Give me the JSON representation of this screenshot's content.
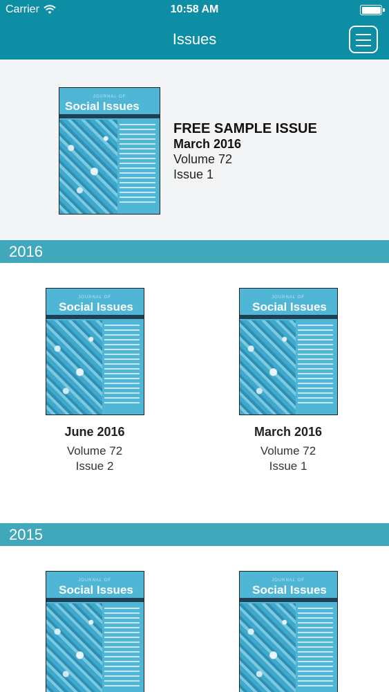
{
  "status_bar": {
    "carrier": "Carrier",
    "time": "10:58 AM",
    "wifi_icon": "wifi-icon",
    "battery_icon": "battery-icon"
  },
  "nav": {
    "title": "Issues",
    "menu_icon": "hamburger-menu-icon"
  },
  "colors": {
    "navbar": "#0d8ea4",
    "section_header": "#41a7ba",
    "featured_bg": "#f3f4f5",
    "cover": "#4fb6d6"
  },
  "featured": {
    "label": "FREE SAMPLE ISSUE",
    "date": "March 2016",
    "volume": "Volume 72",
    "issue": "Issue 1",
    "cover": {
      "journal": "Social Issues"
    }
  },
  "sections": [
    {
      "year": "2016",
      "issues": [
        {
          "date": "June 2016",
          "volume": "Volume 72",
          "issue": "Issue 2",
          "cover": {
            "journal": "Social Issues"
          }
        },
        {
          "date": "March 2016",
          "volume": "Volume 72",
          "issue": "Issue 1",
          "cover": {
            "journal": "Social Issues"
          }
        }
      ]
    },
    {
      "year": "2015",
      "issues": [
        {
          "date": "",
          "volume": "",
          "issue": "",
          "cover": {
            "journal": "Social Issues"
          }
        },
        {
          "date": "",
          "volume": "",
          "issue": "",
          "cover": {
            "journal": "Social Issues"
          }
        }
      ]
    }
  ]
}
